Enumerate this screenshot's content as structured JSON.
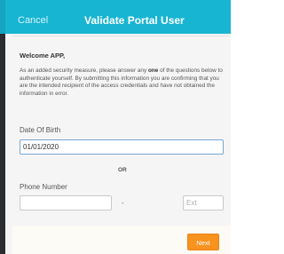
{
  "header": {
    "cancel_label": "Cancel",
    "title": "Validate Portal User"
  },
  "content": {
    "welcome": "Welcome APP,",
    "intro_before": "As an added security measure, please answer any ",
    "intro_emphasis": "one",
    "intro_after": " of the questions below to authenticate yourself. By submitting this information you are confirming that you are the intended recipient of the access credentials and have not obtained the information in error."
  },
  "form": {
    "dob_label": "Date Of Birth",
    "dob_value": "01/01/2020",
    "or_label": "OR",
    "phone_label": "Phone Number",
    "phone_value": "",
    "dash": "-",
    "ext_placeholder": "Ext"
  },
  "footer": {
    "next_label": "Next"
  },
  "colors": {
    "header": "#18b5d2",
    "accent_button": "#f7931e"
  }
}
